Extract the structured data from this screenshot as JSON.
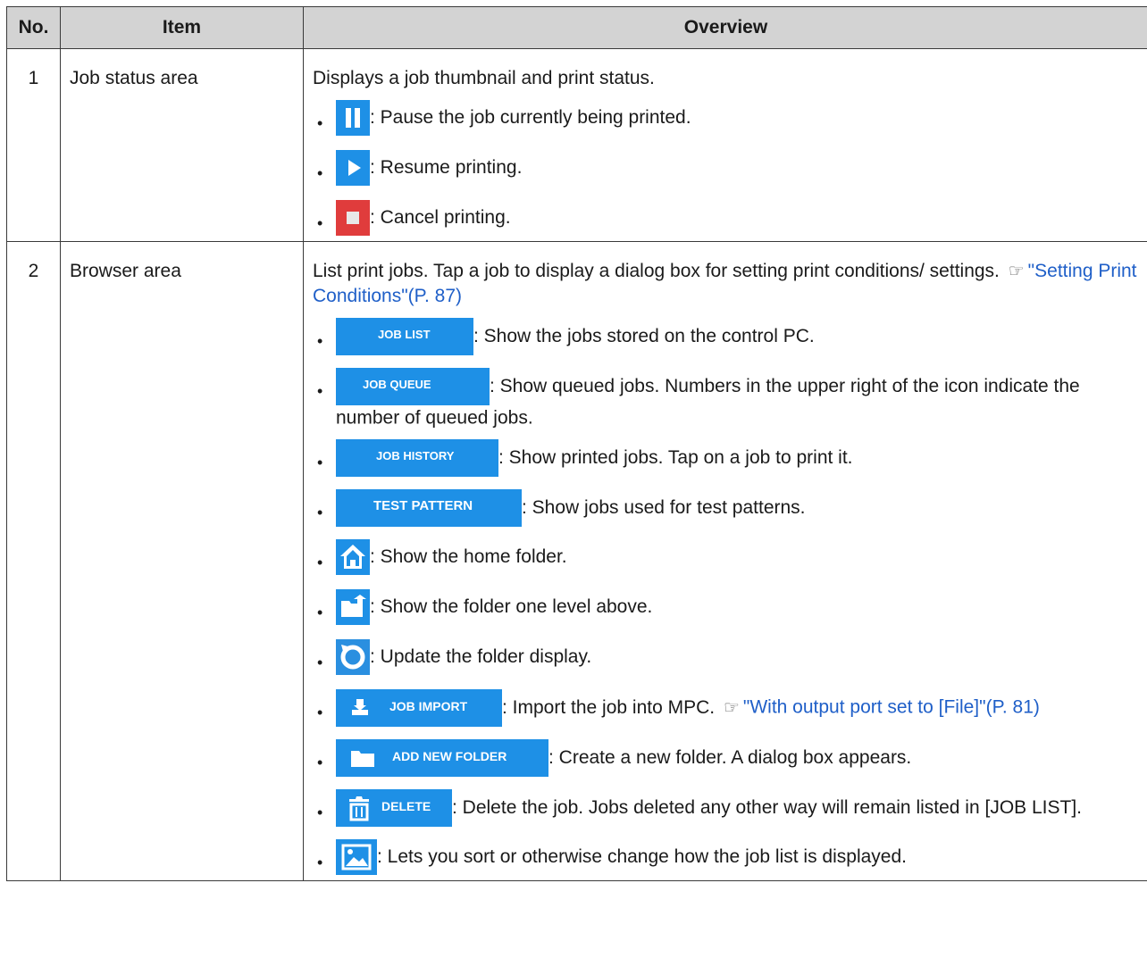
{
  "header": {
    "no": "No.",
    "item": "Item",
    "overview": "Overview"
  },
  "rows": [
    {
      "no": "1",
      "item": "Job status area",
      "overview": "Displays a job thumbnail and print status.",
      "bullets": [
        {
          "icon": "pause-icon",
          "text": ": Pause the job currently being printed."
        },
        {
          "icon": "play-icon",
          "text": ": Resume printing."
        },
        {
          "icon": "stop-icon",
          "text": ": Cancel printing."
        }
      ]
    },
    {
      "no": "2",
      "item": "Browser area",
      "overview_pre": "List print jobs. Tap a job to display a dialog box for setting print conditions/ settings.",
      "overview_link": "\"Setting Print Conditions\"(P. 87)",
      "bullets": [
        {
          "icon": "job-list-button",
          "label": "JOB LIST",
          "text": ": Show the jobs stored on the control PC."
        },
        {
          "icon": "job-queue-button",
          "label": "JOB QUEUE",
          "text": ": Show queued jobs. Numbers in the upper right of the icon indicate the number of queued jobs."
        },
        {
          "icon": "job-history-button",
          "label": "JOB HISTORY",
          "text": ": Show printed jobs. Tap on a job to print it."
        },
        {
          "icon": "test-pattern-button",
          "label": "TEST PATTERN",
          "text": ": Show jobs used for test patterns."
        },
        {
          "icon": "home-icon",
          "text": ": Show the home folder."
        },
        {
          "icon": "folder-up-icon",
          "text": ": Show the folder one level above."
        },
        {
          "icon": "refresh-icon",
          "text": ": Update the folder display."
        },
        {
          "icon": "job-import-button",
          "label": "JOB IMPORT",
          "text": ": Import the job into MPC.",
          "link": "\"With output port set to [File]\"(P. 81)"
        },
        {
          "icon": "add-new-folder-button",
          "label": "ADD NEW FOLDER",
          "text": ": Create a new folder. A dialog box appears."
        },
        {
          "icon": "delete-button",
          "label": "DELETE",
          "text": ": Delete the job. Jobs deleted any other way will remain listed in [JOB LIST]."
        },
        {
          "icon": "image-view-icon",
          "text": ":  Lets you sort or otherwise change how the job list is displayed."
        }
      ]
    }
  ],
  "colors": {
    "header_bg": "#d3d3d3",
    "icon_blue": "#1e90e6",
    "stop_red": "#e03c3c",
    "link": "#1f5fc8"
  }
}
